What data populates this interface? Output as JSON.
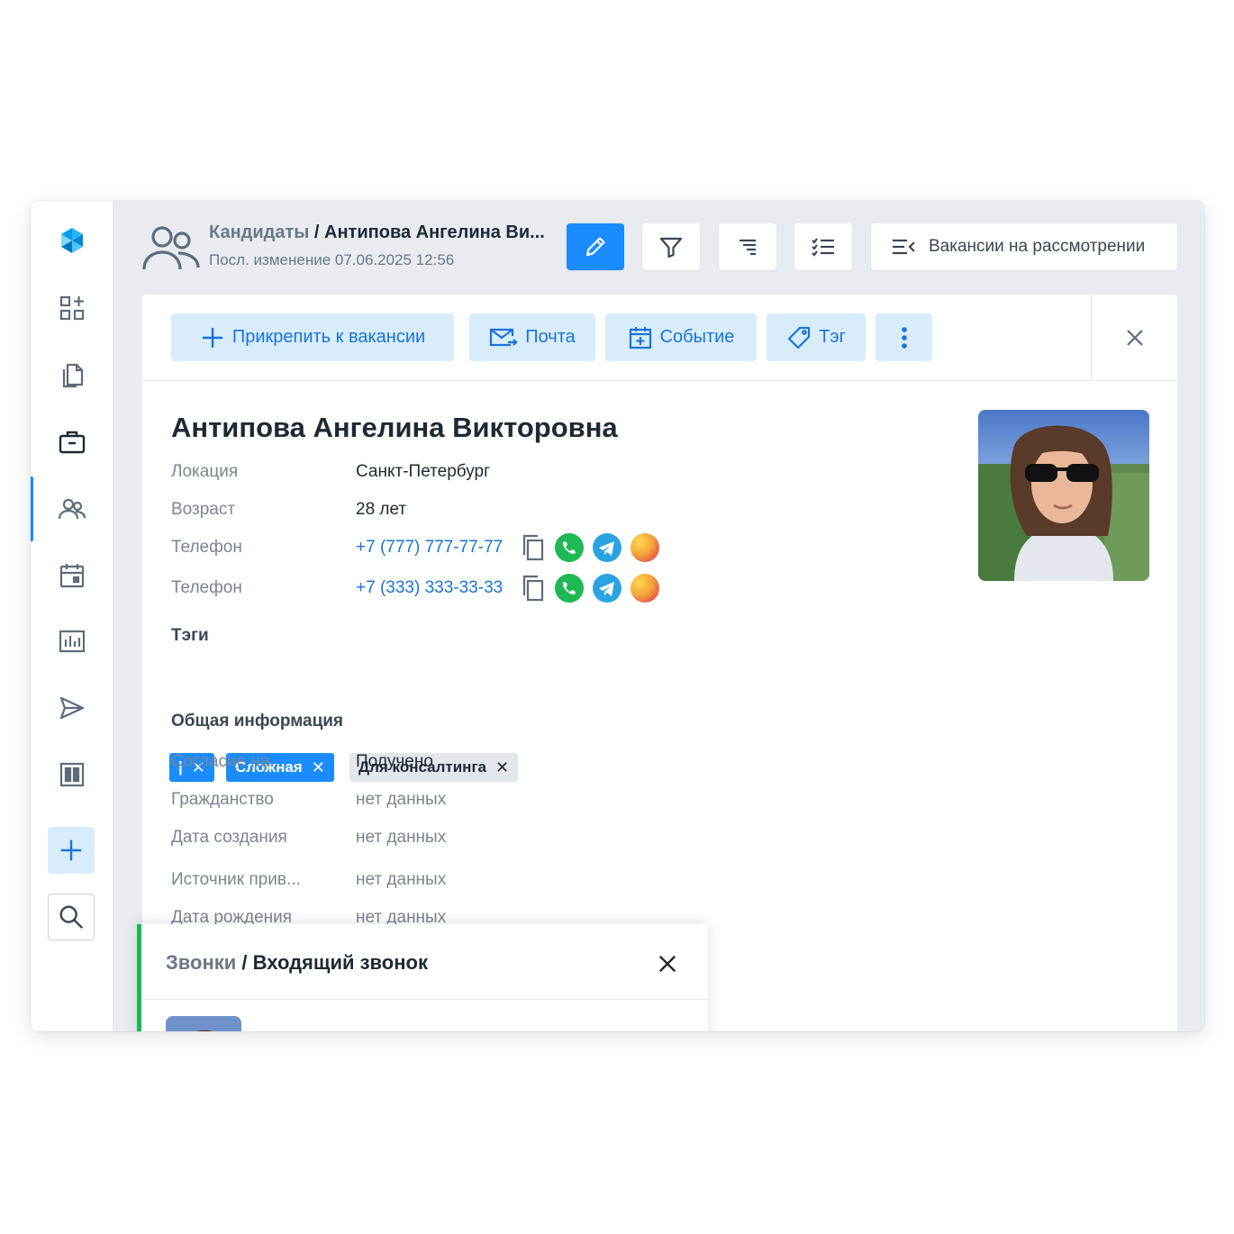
{
  "header": {
    "breadcrumb_parent": "Кандидаты",
    "breadcrumb_separator": "/",
    "breadcrumb_current": "Антипова Ангелина Ви...",
    "modified": "Посл. изменение 07.06.2025 12:56",
    "vacancies_label": "Вакансии на рассмотрении"
  },
  "toolbar": {
    "attach_label": "Прикрепить к вакансии",
    "mail_label": "Почта",
    "event_label": "Событие",
    "tag_label": "Тэг"
  },
  "candidate": {
    "name": "Антипова Ангелина Викторовна",
    "fields": [
      {
        "label": "Локация",
        "value": "Санкт-Петербург"
      },
      {
        "label": "Возраст",
        "value": "28 лет"
      }
    ],
    "phones": [
      {
        "label": "Телефон",
        "value": "+7 (777) 777-77-77"
      },
      {
        "label": "Телефон",
        "value": "+7 (333) 333-33-33"
      }
    ]
  },
  "tags": {
    "title": "Тэги",
    "items": [
      {
        "label": "|",
        "remove": "✕"
      },
      {
        "label": "Сложная",
        "remove": "✕"
      },
      {
        "label": "Для консалтинга",
        "remove": "✕"
      }
    ]
  },
  "general": {
    "title": "Общая информация",
    "fields": [
      {
        "label": "Согласие на...",
        "value": "Получено"
      },
      {
        "label": "Гражданство",
        "value": "нет данных"
      },
      {
        "label": "Дата создания",
        "value": "нет данных"
      },
      {
        "label": "Источник прив...",
        "value": "нет данных"
      },
      {
        "label": "Дата рождения",
        "value": "нет данных"
      }
    ]
  },
  "call": {
    "parent": "Звонки",
    "separator": "/",
    "current": "Входящий звонок"
  },
  "colors": {
    "accent": "#1a8cff",
    "accent_light": "#d9ecfb",
    "link": "#1a73d9",
    "whatsapp": "#25d366",
    "telegram": "#2aa3e0",
    "call_border": "#1db954"
  }
}
